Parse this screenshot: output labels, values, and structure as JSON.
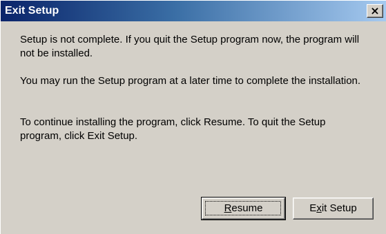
{
  "window": {
    "title": "Exit Setup",
    "close_glyph": "×"
  },
  "messages": [
    "Setup is not complete.  If you quit the Setup program now, the program will not be installed.",
    "You may run the Setup program at a later time to complete the installation.",
    "To continue installing the program, click Resume.  To quit the Setup program, click Exit Setup."
  ],
  "buttons": {
    "resume": {
      "before": "",
      "mnemonic": "R",
      "after": "esume"
    },
    "exit": {
      "before": "E",
      "mnemonic": "x",
      "after": "it Setup"
    }
  },
  "colors": {
    "title_gradient_start": "#0a246a",
    "title_gradient_end": "#a6caf0",
    "dialog_face": "#d4d0c8"
  },
  "icons": {
    "close": "close-icon"
  }
}
